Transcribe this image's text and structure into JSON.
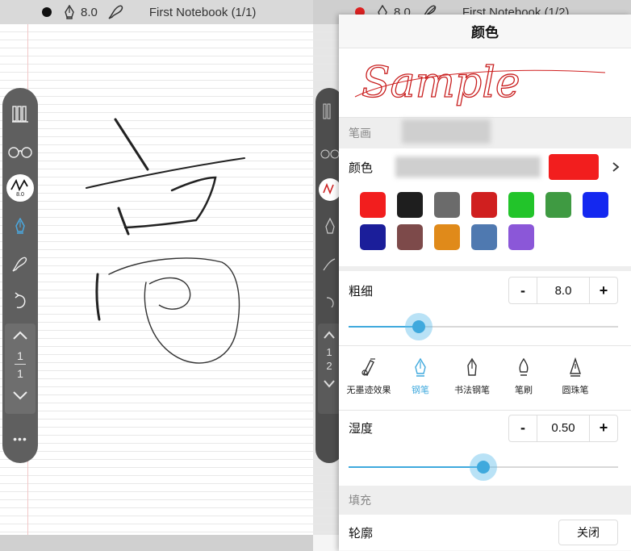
{
  "left_screen": {
    "status": {
      "size": "8.0",
      "title": "First Notebook (1/1)"
    },
    "toolbar": {
      "tools": [
        "library-icon",
        "glasses-icon",
        "pen-size-icon",
        "fountain-pen-icon",
        "brush-icon",
        "undo-icon"
      ],
      "pen_size_badge": "8.0",
      "page_current": "1",
      "page_total": "1",
      "more": "•••"
    }
  },
  "right_screen": {
    "status": {
      "size": "8.0",
      "title": "First Notebook (1/2)"
    },
    "pager": {
      "page_current": "1",
      "page_total": "2"
    }
  },
  "color_panel": {
    "title": "颜色",
    "sample_text": "Sample",
    "stroke_section": "笔画",
    "color_label": "颜色",
    "current_color": "#f21e1e",
    "swatches": [
      "#f21e1e",
      "#1e1e1e",
      "#6b6b6b",
      "#d01f1f",
      "#22c42a",
      "#3f9a42",
      "#1428f0",
      "#1b1e9a",
      "#7d4a4a",
      "#e08a1a",
      "#4f79b0",
      "#8b57d8"
    ],
    "thickness_label": "粗细",
    "thickness_value": "8.0",
    "thickness_level": 0.26,
    "pen_types": [
      {
        "label": "无墨迹效果",
        "icon": "no-ink-pen-icon",
        "active": false
      },
      {
        "label": "钢笔",
        "icon": "fountain-pen-icon",
        "active": true
      },
      {
        "label": "书法钢笔",
        "icon": "calligraphy-pen-icon",
        "active": false
      },
      {
        "label": "笔刷",
        "icon": "brush-pen-icon",
        "active": false
      },
      {
        "label": "圆珠笔",
        "icon": "ballpoint-pen-icon",
        "active": false
      }
    ],
    "wetness_label": "湿度",
    "wetness_value": "0.50",
    "wetness_level": 0.5,
    "fill_section": "填充",
    "outline_label": "轮廓",
    "close_button": "关闭",
    "minus": "-",
    "plus": "+"
  },
  "accent_color": "#3fa9dd"
}
